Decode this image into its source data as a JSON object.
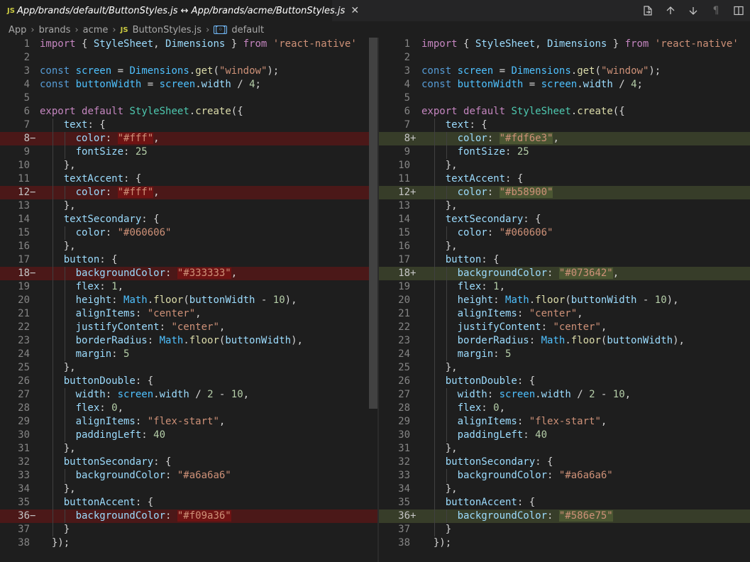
{
  "tab": {
    "lang": "JS",
    "title": "App/brands/default/ButtonStyles.js ↔ App/brands/acme/ButtonStyles.js",
    "close_icon": "close-icon"
  },
  "actions": [
    "open-file-icon",
    "arrow-up-icon",
    "arrow-down-icon",
    "pilcrow-icon",
    "split-editor-icon"
  ],
  "breadcrumb": {
    "items": [
      "App",
      "brands",
      "acme"
    ],
    "file_lang": "JS",
    "file": "ButtonStyles.js",
    "symbol": "default"
  },
  "left_pane": {
    "marker_removed": "−",
    "line_numbers": [
      "1",
      "2",
      "3",
      "4",
      "5",
      "6",
      "7",
      "8",
      "9",
      "10",
      "11",
      "12",
      "13",
      "14",
      "15",
      "16",
      "17",
      "18",
      "19",
      "20",
      "21",
      "22",
      "23",
      "24",
      "25",
      "26",
      "27",
      "28",
      "29",
      "30",
      "31",
      "32",
      "33",
      "34",
      "35",
      "36",
      "37",
      "38"
    ],
    "changed": {
      "8": "#fff",
      "12": "#fff",
      "18": "#333333",
      "36": "#f09a36"
    }
  },
  "right_pane": {
    "marker_added": "+",
    "line_numbers": [
      "1",
      "2",
      "3",
      "4",
      "5",
      "6",
      "7",
      "8",
      "9",
      "10",
      "11",
      "12",
      "13",
      "14",
      "15",
      "16",
      "17",
      "18",
      "19",
      "20",
      "21",
      "22",
      "23",
      "24",
      "25",
      "26",
      "27",
      "28",
      "29",
      "30",
      "31",
      "32",
      "33",
      "34",
      "35",
      "36",
      "37",
      "38"
    ],
    "changed": {
      "8": "#fdf6e3",
      "12": "#b58900",
      "18": "#073642",
      "36": "#586e75"
    }
  },
  "code": {
    "import_kw": "import",
    "import_lb": "{ ",
    "import_a": "StyleSheet",
    "import_comma": ", ",
    "import_b": "Dimensions",
    "import_rb": " } ",
    "from_kw": "from",
    "module": "'react-native'",
    "const_kw": "const",
    "screen_var": "screen",
    "eq": " = ",
    "dims": "Dimensions",
    "dot": ".",
    "get_fn": "get",
    "window_str": "\"window\"",
    "bw_var": "buttonWidth",
    "width_prop": "width",
    "div4": " / ",
    "four": "4",
    "export_kw": "export",
    "default_kw": "default",
    "stylesheet": "StyleSheet",
    "create_fn": "create",
    "keys": {
      "text": "text",
      "textAccent": "textAccent",
      "textSecondary": "textSecondary",
      "button": "button",
      "buttonDouble": "buttonDouble",
      "buttonSecondary": "buttonSecondary",
      "buttonAccent": "buttonAccent",
      "color": "color",
      "fontSize": "fontSize",
      "backgroundColor": "backgroundColor",
      "flex": "flex",
      "height": "height",
      "alignItems": "alignItems",
      "justifyContent": "justifyContent",
      "borderRadius": "borderRadius",
      "margin": "margin",
      "width": "width",
      "paddingLeft": "paddingLeft"
    },
    "values": {
      "fs25": "25",
      "c060606": "\"#060606\"",
      "one": "1",
      "zero": "0",
      "five": "5",
      "forty": "40",
      "ten": "10",
      "two": "2",
      "center": "\"center\"",
      "flexstart": "\"flex-start\"",
      "a6a6a6": "\"#a6a6a6\"",
      "Math": "Math",
      "floor": "floor"
    }
  }
}
